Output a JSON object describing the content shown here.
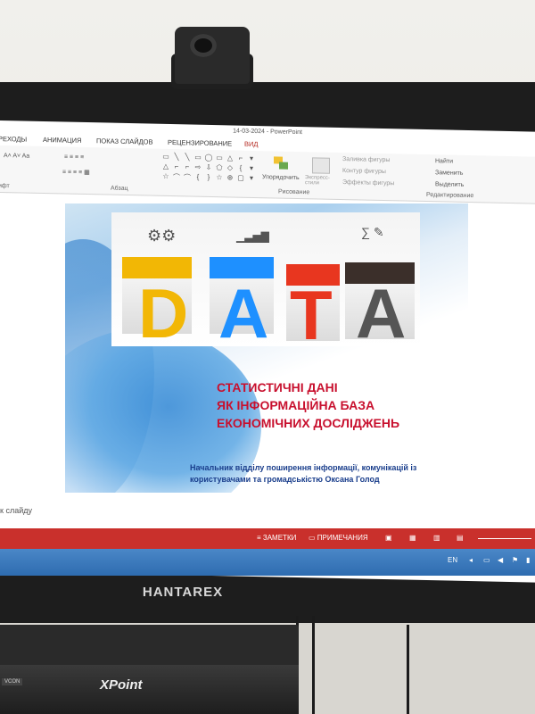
{
  "window": {
    "title": "14-03-2024 - PowerPoint"
  },
  "ribbon_tabs": [
    "РЕХОДЫ",
    "АНИМАЦИЯ",
    "ПОКАЗ СЛАЙДОВ",
    "РЕЦЕНЗИРОВАНИЕ",
    "ВИД"
  ],
  "ribbon": {
    "groups": {
      "font": "ифт",
      "paragraph": "Абзац",
      "drawing": "Рисование",
      "editing": "Редактирование"
    },
    "arrange_label": "Упорядочить",
    "quick_styles_label": "Экспресс-стили",
    "shape_fill": "Заливка фигуры",
    "shape_outline": "Контур фигуры",
    "shape_effects": "Эффекты фигуры",
    "find": "Найти",
    "replace": "Заменить",
    "select": "Выделить"
  },
  "slide": {
    "image_letters": [
      "D",
      "A",
      "T",
      "A"
    ],
    "title_lines": [
      "СТАТИСТИЧНІ ДАНІ",
      "ЯК ІНФОРМАЦІЙНА БАЗА",
      "ЕКОНОМІЧНИХ ДОСЛІДЖЕНЬ"
    ],
    "subtitle": "Начальник відділу поширення інформації, комунікацій із користувачами та громадськістю Оксана Голод"
  },
  "notes_hint": "к слайду",
  "statusbar": {
    "notes": "ЗАМЕТКИ",
    "comments": "ПРИМЕЧАНИЯ"
  },
  "taskbar": {
    "lang": "EN"
  },
  "hardware": {
    "monitor_brand": "HANTAREX",
    "kvm_brand": "XPoint",
    "kvm_tag": "VCON"
  },
  "colors": {
    "title_red": "#c8102e",
    "subtitle_blue": "#1a3e8c",
    "statusbar_red": "#c9302c"
  }
}
